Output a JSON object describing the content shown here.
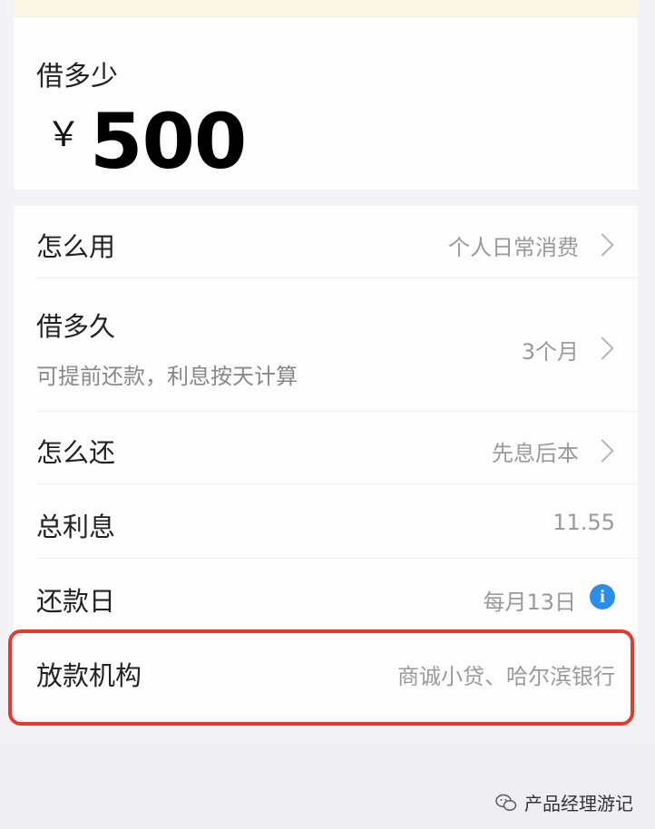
{
  "amount_section": {
    "label": "借多少",
    "currency": "￥",
    "amount": "500"
  },
  "rows": [
    {
      "label": "怎么用",
      "value": "个人日常消费"
    },
    {
      "label": "借多久",
      "sub": "可提前还款，利息按天计算",
      "value": "3个月"
    },
    {
      "label": "怎么还",
      "value": "先息后本"
    },
    {
      "label": "总利息",
      "value": "11.55"
    },
    {
      "label": "还款日",
      "value": "每月13日"
    },
    {
      "label": "放款机构",
      "value": "商诚小贷、哈尔滨银行"
    }
  ],
  "icons": {
    "info": "i",
    "chevron": "chevron-right-icon"
  },
  "watermark": {
    "text": "产品经理游记"
  },
  "colors": {
    "highlight": "#e23b2e",
    "info_icon": "#2b8de8"
  }
}
